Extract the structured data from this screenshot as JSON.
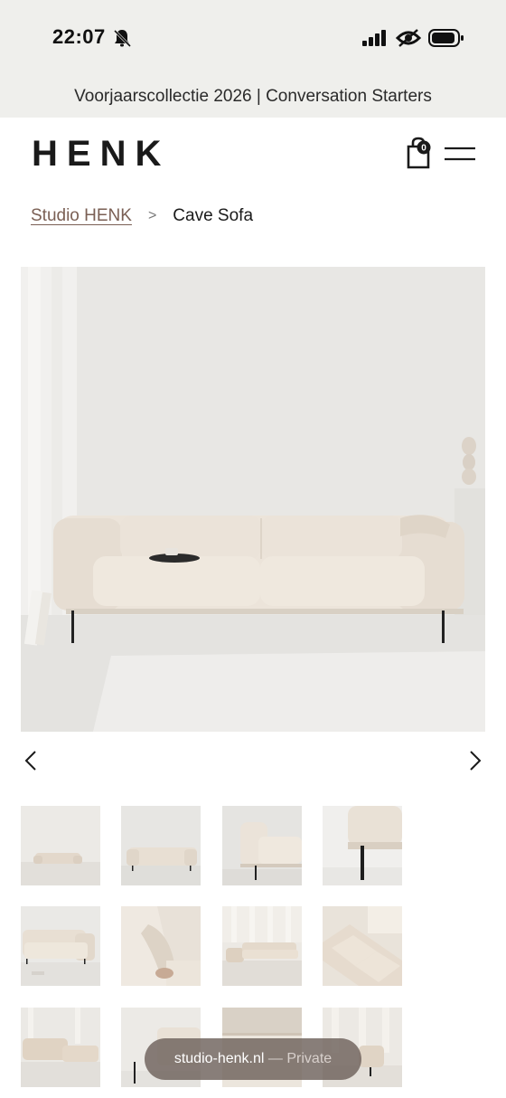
{
  "status_bar": {
    "time": "22:07",
    "icons": [
      "bell-muted-icon",
      "signal-icon",
      "focus-icon",
      "battery-icon"
    ]
  },
  "promo": {
    "text": "Voorjaarscollectie 2026 | Conversation Starters"
  },
  "header": {
    "logo": "HENK",
    "cart_badge": "0",
    "icons": [
      "cart-icon",
      "menu-icon"
    ]
  },
  "breadcrumb": {
    "parent": "Studio HENK",
    "separator": ">",
    "current": "Cave Sofa"
  },
  "gallery": {
    "prev_icon": "chevron-left-icon",
    "next_icon": "chevron-right-icon",
    "thumbnail_count": 12
  },
  "browser": {
    "domain": "studio-henk.nl",
    "separator": "—",
    "mode": "Private"
  },
  "colors": {
    "top_background": "#efefec",
    "breadcrumb_link": "#7a5f54",
    "sofa": "#ece4da",
    "pill": "#6e625c"
  }
}
